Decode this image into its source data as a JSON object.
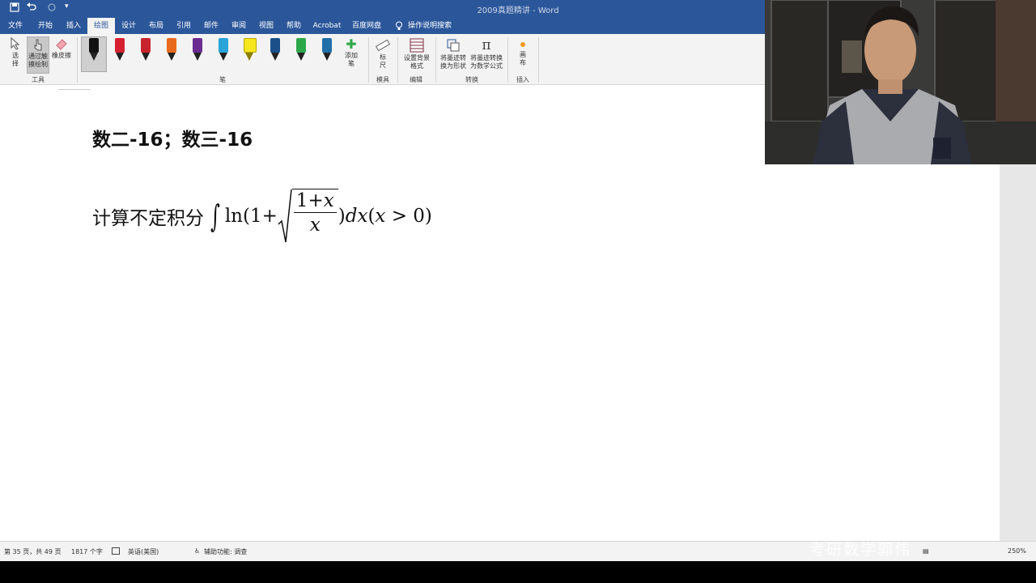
{
  "titlebar": {
    "doc_title": "2009真题精讲  -  Word",
    "quick_access": {
      "save_icon": "save-icon",
      "undo_icon": "undo-icon",
      "redo_icon": "redo-icon",
      "customize_icon": "chevron-down-icon"
    }
  },
  "tabs": [
    {
      "label": "文件",
      "active": false
    },
    {
      "label": "开始",
      "active": false
    },
    {
      "label": "插入",
      "active": false
    },
    {
      "label": "绘图",
      "active": true
    },
    {
      "label": "设计",
      "active": false
    },
    {
      "label": "布局",
      "active": false
    },
    {
      "label": "引用",
      "active": false
    },
    {
      "label": "邮件",
      "active": false
    },
    {
      "label": "审阅",
      "active": false
    },
    {
      "label": "视图",
      "active": false
    },
    {
      "label": "帮助",
      "active": false
    },
    {
      "label": "Acrobat",
      "active": false
    },
    {
      "label": "百度网盘",
      "active": false
    },
    {
      "label": "操作说明搜索",
      "active": false
    }
  ],
  "ribbon": {
    "tools": {
      "select": "选\n择",
      "touch_draw": "通过触\n摸绘制",
      "eraser": "橡皮擦",
      "group": "工具"
    },
    "pens": {
      "colors": [
        "#111111",
        "#d62030",
        "#c8232c",
        "#e86a1c",
        "#6a2c91",
        "#27a4d8",
        "#f5e61e",
        "#1b4f8a",
        "#2ca84a",
        "#1f6fa8"
      ],
      "add_pen": "添加\n笔",
      "group": "笔"
    },
    "stencils": {
      "ruler": "标\n尺",
      "group": "模具"
    },
    "edit": {
      "background": "设置背景\n格式",
      "group": "编辑"
    },
    "convert": {
      "to_shape": "将墨迹转\n换为形状",
      "to_math": "将墨迹转换\n为数学公式",
      "group": "转换"
    },
    "insert": {
      "canvas": "画\n布",
      "group": "插入"
    }
  },
  "document": {
    "heading": "数二-16；数三-16",
    "problem": {
      "prefix": "计算不定积分",
      "ln": "ln(1+",
      "num": "1+",
      "den_var": "x",
      "num_var": "x",
      "suffix_close": ")",
      "dx": "dx",
      "cond_open": "(",
      "cond_var": "x",
      "cond_rest": " > 0)"
    }
  },
  "statusbar": {
    "page": "第 35 页，共 49 页",
    "words": "1817 个字",
    "lang": "英语(美国)",
    "accessibility": "辅助功能: 调查",
    "zoom": "250%"
  },
  "watermark": "考研数学郭伟"
}
